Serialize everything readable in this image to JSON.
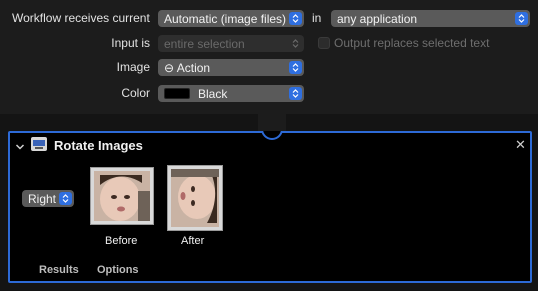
{
  "workflow": {
    "receives_label": "Workflow receives current",
    "receives_value": "Automatic (image files)",
    "in_label": "in",
    "in_value": "any application",
    "input_is_label": "Input is",
    "input_is_value": "entire selection",
    "output_replaces_label": "Output replaces selected text",
    "image_label": "Image",
    "image_value": "⊖ Action",
    "color_label": "Color",
    "color_value": "Black"
  },
  "action": {
    "title": "Rotate Images",
    "direction_value": "Right",
    "before_label": "Before",
    "after_label": "After",
    "tabs": [
      "Results",
      "Options"
    ]
  },
  "colors": {
    "accent": "#2d6ad6",
    "popup_bg": "#5a5a5a",
    "panel_bg": "#000000"
  },
  "icons": [
    "chevron-down-icon",
    "automator-action-icon",
    "close-icon",
    "up-down-arrows-icon"
  ]
}
